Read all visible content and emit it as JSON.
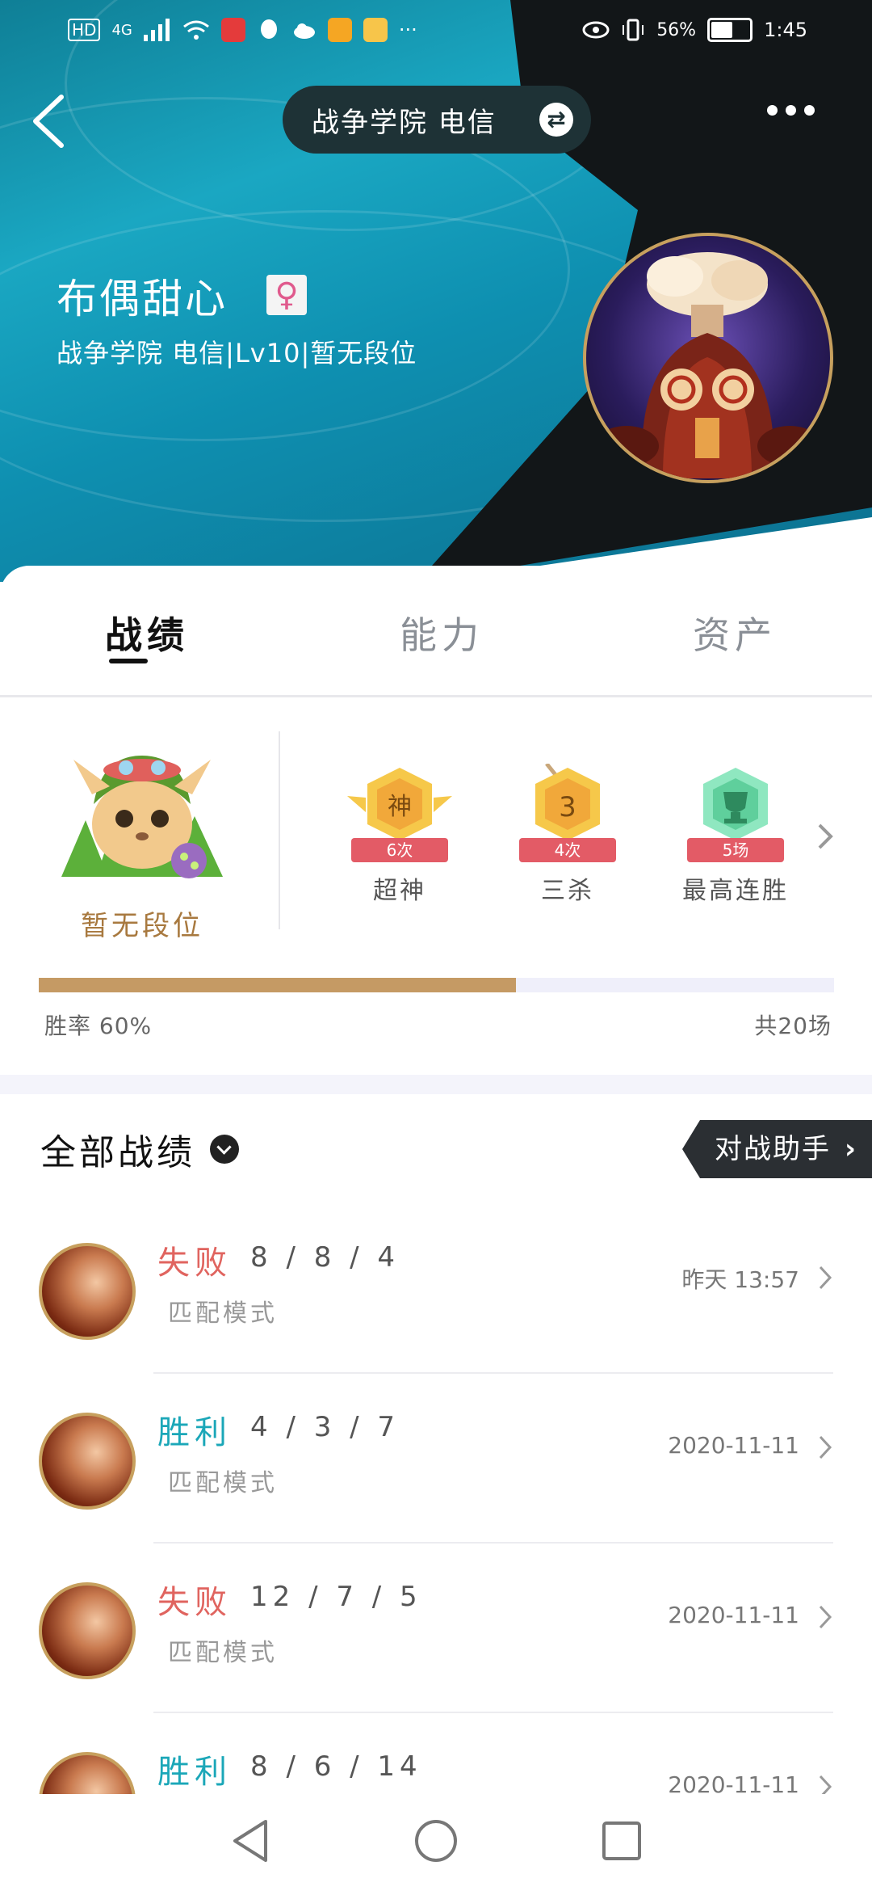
{
  "status_bar": {
    "network_labels": [
      "HD",
      "4G"
    ],
    "battery_percent": "56%",
    "time": "1:45"
  },
  "header": {
    "server_label": "战争学院 电信",
    "player_name": "布偶甜心",
    "gender_symbol": "♀",
    "player_info": "战争学院 电信|Lv10|暂无段位"
  },
  "tabs": [
    {
      "label": "战绩",
      "active": true
    },
    {
      "label": "能力",
      "active": false
    },
    {
      "label": "资产",
      "active": false
    }
  ],
  "stats": {
    "rank_label": "暂无段位",
    "honors": [
      {
        "badge": "神",
        "count": "6次",
        "label": "超神",
        "color": "#f6c84a"
      },
      {
        "badge": "3",
        "count": "4次",
        "label": "三杀",
        "color": "#f6c84a"
      },
      {
        "badge": "🏆",
        "count": "5场",
        "label": "最高连胜",
        "color": "#7fe0b3"
      }
    ],
    "win_rate_fraction": 0.6,
    "win_rate_text": "胜率 60%",
    "total_games_text": "共20场"
  },
  "match_list": {
    "title": "全部战绩",
    "assistant_button": "对战助手",
    "matches": [
      {
        "result": "失败",
        "kda": "8 / 8 / 4",
        "mode": "匹配模式",
        "time": "昨天 13:57",
        "win": false
      },
      {
        "result": "胜利",
        "kda": "4 / 3 / 7",
        "mode": "匹配模式",
        "time": "2020-11-11",
        "win": true
      },
      {
        "result": "失败",
        "kda": "12 / 7 / 5",
        "mode": "匹配模式",
        "time": "2020-11-11",
        "win": false
      },
      {
        "result": "胜利",
        "kda": "8 / 6 / 14",
        "mode": "",
        "time": "2020-11-11",
        "win": true
      }
    ]
  },
  "colors": {
    "progress": "#c59a64",
    "win": "#1ba7b8",
    "lose": "#e0645f",
    "accent_gold": "#c7a05e"
  }
}
